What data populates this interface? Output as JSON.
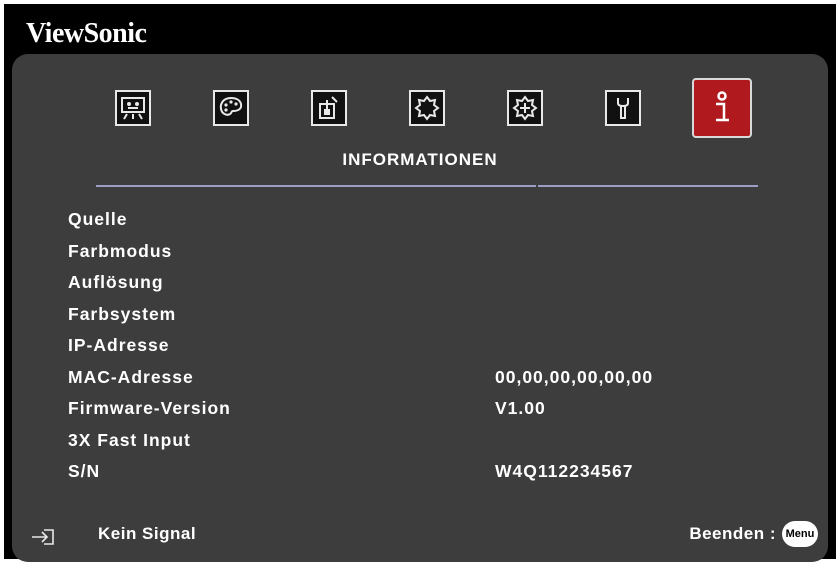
{
  "brand": "ViewSonic",
  "tabs": [
    {
      "icon": "display-icon",
      "active": false
    },
    {
      "icon": "palette-icon",
      "active": false
    },
    {
      "icon": "power-icon",
      "active": false
    },
    {
      "icon": "gear-icon",
      "active": false
    },
    {
      "icon": "advanced-gear-icon",
      "active": false
    },
    {
      "icon": "wrench-icon",
      "active": false
    },
    {
      "icon": "info-icon",
      "active": true
    }
  ],
  "section_title": "INFORMATIONEN",
  "info_rows": [
    {
      "label": "Quelle",
      "value": ""
    },
    {
      "label": "Farbmodus",
      "value": ""
    },
    {
      "label": "Auflösung",
      "value": ""
    },
    {
      "label": "Farbsystem",
      "value": ""
    },
    {
      "label": "IP-Adresse",
      "value": ""
    },
    {
      "label": "MAC-Adresse",
      "value": "00,00,00,00,00,00"
    },
    {
      "label": "Firmware-Version",
      "value": "V1.00"
    },
    {
      "label": "3X Fast Input",
      "value": ""
    },
    {
      "label": "S/N",
      "value": "W4Q112234567"
    }
  ],
  "footer": {
    "signal_label": "Kein Signal",
    "exit_label": "Beenden :",
    "menu_key": "Menu"
  },
  "colors": {
    "panel": "#3d3d3d",
    "active_tab": "#b01a1f",
    "rule": "#9a9ec2",
    "text": "#ffffff"
  }
}
